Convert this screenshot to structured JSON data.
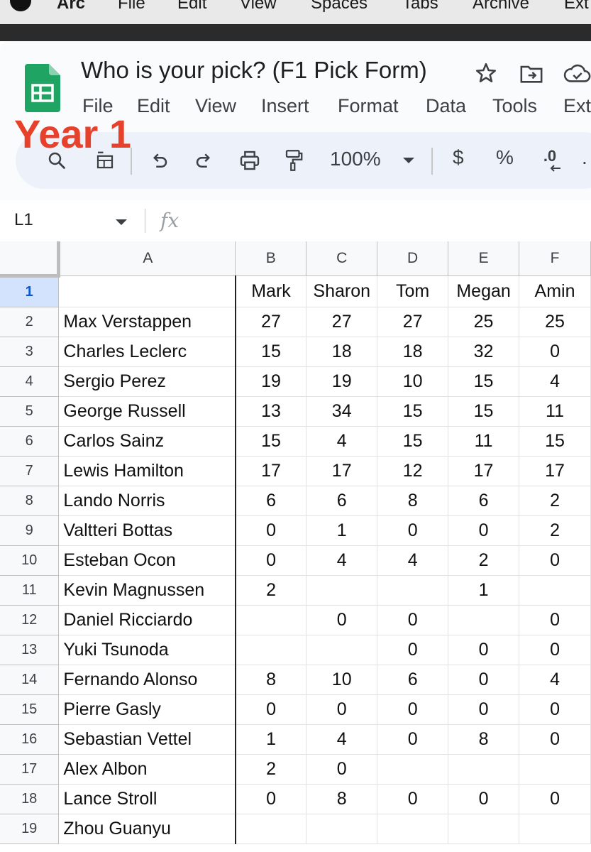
{
  "menubar": {
    "app_name": "Arc",
    "items": [
      "File",
      "Edit",
      "View",
      "Spaces",
      "Tabs",
      "Archive",
      "Ext"
    ]
  },
  "document": {
    "title": "Who is your pick? (F1 Pick Form)"
  },
  "sheets_menu": [
    "File",
    "Edit",
    "View",
    "Insert",
    "Format",
    "Data",
    "Tools",
    "Ext"
  ],
  "overlay": {
    "text": "Year 1",
    "color": "#e8412b"
  },
  "toolbar": {
    "zoom": "100%",
    "currency": "$",
    "percent": "%",
    "decimal_decrease": ".0"
  },
  "formula_bar": {
    "cell_ref": "L1",
    "fx_label": "fx"
  },
  "columns": [
    "A",
    "B",
    "C",
    "D",
    "E",
    "F"
  ],
  "header_row": [
    "",
    "Mark",
    "Sharon",
    "Tom",
    "Megan",
    "Amin"
  ],
  "rows": [
    {
      "num": "2",
      "name": "Max Verstappen",
      "values": [
        "27",
        "27",
        "27",
        "25",
        "25"
      ]
    },
    {
      "num": "3",
      "name": "Charles Leclerc",
      "values": [
        "15",
        "18",
        "18",
        "32",
        "0"
      ]
    },
    {
      "num": "4",
      "name": "Sergio Perez",
      "values": [
        "19",
        "19",
        "10",
        "15",
        "4"
      ]
    },
    {
      "num": "5",
      "name": "George Russell",
      "values": [
        "13",
        "34",
        "15",
        "15",
        "11"
      ]
    },
    {
      "num": "6",
      "name": "Carlos Sainz",
      "values": [
        "15",
        "4",
        "15",
        "11",
        "15"
      ]
    },
    {
      "num": "7",
      "name": "Lewis Hamilton",
      "values": [
        "17",
        "17",
        "12",
        "17",
        "17"
      ]
    },
    {
      "num": "8",
      "name": "Lando Norris",
      "values": [
        "6",
        "6",
        "8",
        "6",
        "2"
      ]
    },
    {
      "num": "9",
      "name": "Valtteri Bottas",
      "values": [
        "0",
        "1",
        "0",
        "0",
        "2"
      ]
    },
    {
      "num": "10",
      "name": "Esteban Ocon",
      "values": [
        "0",
        "4",
        "4",
        "2",
        "0"
      ]
    },
    {
      "num": "11",
      "name": "Kevin Magnussen",
      "values": [
        "2",
        "",
        "",
        "1",
        ""
      ]
    },
    {
      "num": "12",
      "name": "Daniel Ricciardo",
      "values": [
        "",
        "0",
        "0",
        "",
        "0"
      ]
    },
    {
      "num": "13",
      "name": "Yuki Tsunoda",
      "values": [
        "",
        "",
        "0",
        "0",
        "0"
      ]
    },
    {
      "num": "14",
      "name": "Fernando Alonso",
      "values": [
        "8",
        "10",
        "6",
        "0",
        "4"
      ]
    },
    {
      "num": "15",
      "name": "Pierre Gasly",
      "values": [
        "0",
        "0",
        "0",
        "0",
        "0"
      ]
    },
    {
      "num": "16",
      "name": "Sebastian Vettel",
      "values": [
        "1",
        "4",
        "0",
        "8",
        "0"
      ]
    },
    {
      "num": "17",
      "name": "Alex Albon",
      "values": [
        "2",
        "0",
        "",
        "",
        ""
      ]
    },
    {
      "num": "18",
      "name": "Lance Stroll",
      "values": [
        "0",
        "8",
        "0",
        "0",
        "0"
      ]
    },
    {
      "num": "19",
      "name": "Zhou Guanyu",
      "values": [
        "",
        "",
        "",
        "",
        ""
      ]
    }
  ]
}
